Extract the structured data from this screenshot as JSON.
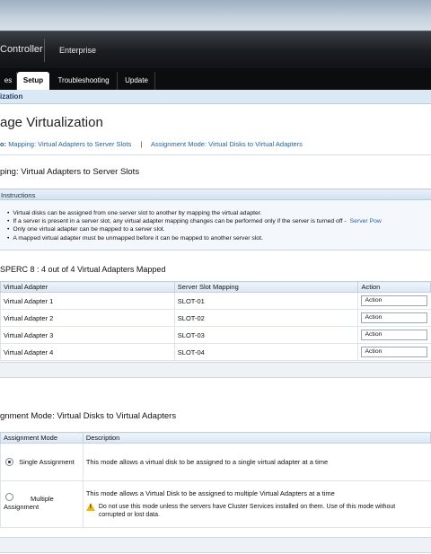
{
  "header": {
    "brand": "Controller",
    "edition": "Enterprise"
  },
  "tabs": [
    {
      "label": "es",
      "active": false
    },
    {
      "label": "Setup",
      "active": true
    },
    {
      "label": "Troubleshooting",
      "active": false
    },
    {
      "label": "Update",
      "active": false
    }
  ],
  "subnav": {
    "label": "ization"
  },
  "page": {
    "title": "age Virtualization",
    "jump_lead": "o:",
    "jump_link1": "Mapping: Virtual Adapters to Server Slots",
    "jump_sep": "|",
    "jump_link2": "Assignment Mode: Virtual Disks to Virtual Adapters"
  },
  "mapping": {
    "title": "ping: Virtual Adapters to Server Slots",
    "instructions_header": "Instructions",
    "instructions": [
      "Virtual disks can be assigned from one server slot to another by mapping the virtual adapter.",
      "If a server is present in a server slot, any virtual adapter mapping changes can be performed only if the server is turned off -",
      "Only one virtual adapter can be mapped to a server slot.",
      "A mapped virtual adapter must be unmapped before it can be mapped to another server slot."
    ],
    "instructions_link": "Server Pow",
    "summary": "SPERC 8 :  4   out of 4 Virtual Adapters Mapped",
    "columns": [
      "Virtual Adapter",
      "Server Slot Mapping",
      "Action"
    ],
    "rows": [
      {
        "adapter": "Virtual Adapter 1",
        "slot": "SLOT-01",
        "action": "Action"
      },
      {
        "adapter": "Virtual Adapter 2",
        "slot": "SLOT-02",
        "action": "Action"
      },
      {
        "adapter": "Virtual Adapter 3",
        "slot": "SLOT-03",
        "action": "Action"
      },
      {
        "adapter": "Virtual Adapter 4",
        "slot": "SLOT-04",
        "action": "Action"
      }
    ]
  },
  "assignment": {
    "title": "gnment Mode: Virtual Disks to Virtual Adapters",
    "columns": [
      "Assignment Mode",
      "Description"
    ],
    "single": {
      "label": "Single Assignment",
      "selected": true,
      "description": "This mode allows a virtual disk to be assigned to a single virtual adapter at a time"
    },
    "multiple": {
      "label_line1": "Multiple",
      "label_line2": "Assignment",
      "selected": false,
      "description": "This mode allows a Virtual Disk to be assigned to multiple Virtual Adapters at a time",
      "warning_line1": "Do not use this mode unless the servers have Cluster Services installed on them. Use of this mode without",
      "warning_line2": "corrupted or lost data."
    }
  },
  "colors": {
    "banner": "#1a1d21",
    "tabbar": "#0c0d0f",
    "link": "#1f5fb0",
    "subbar": "#dbe9f5",
    "warning": "#f2b705"
  }
}
